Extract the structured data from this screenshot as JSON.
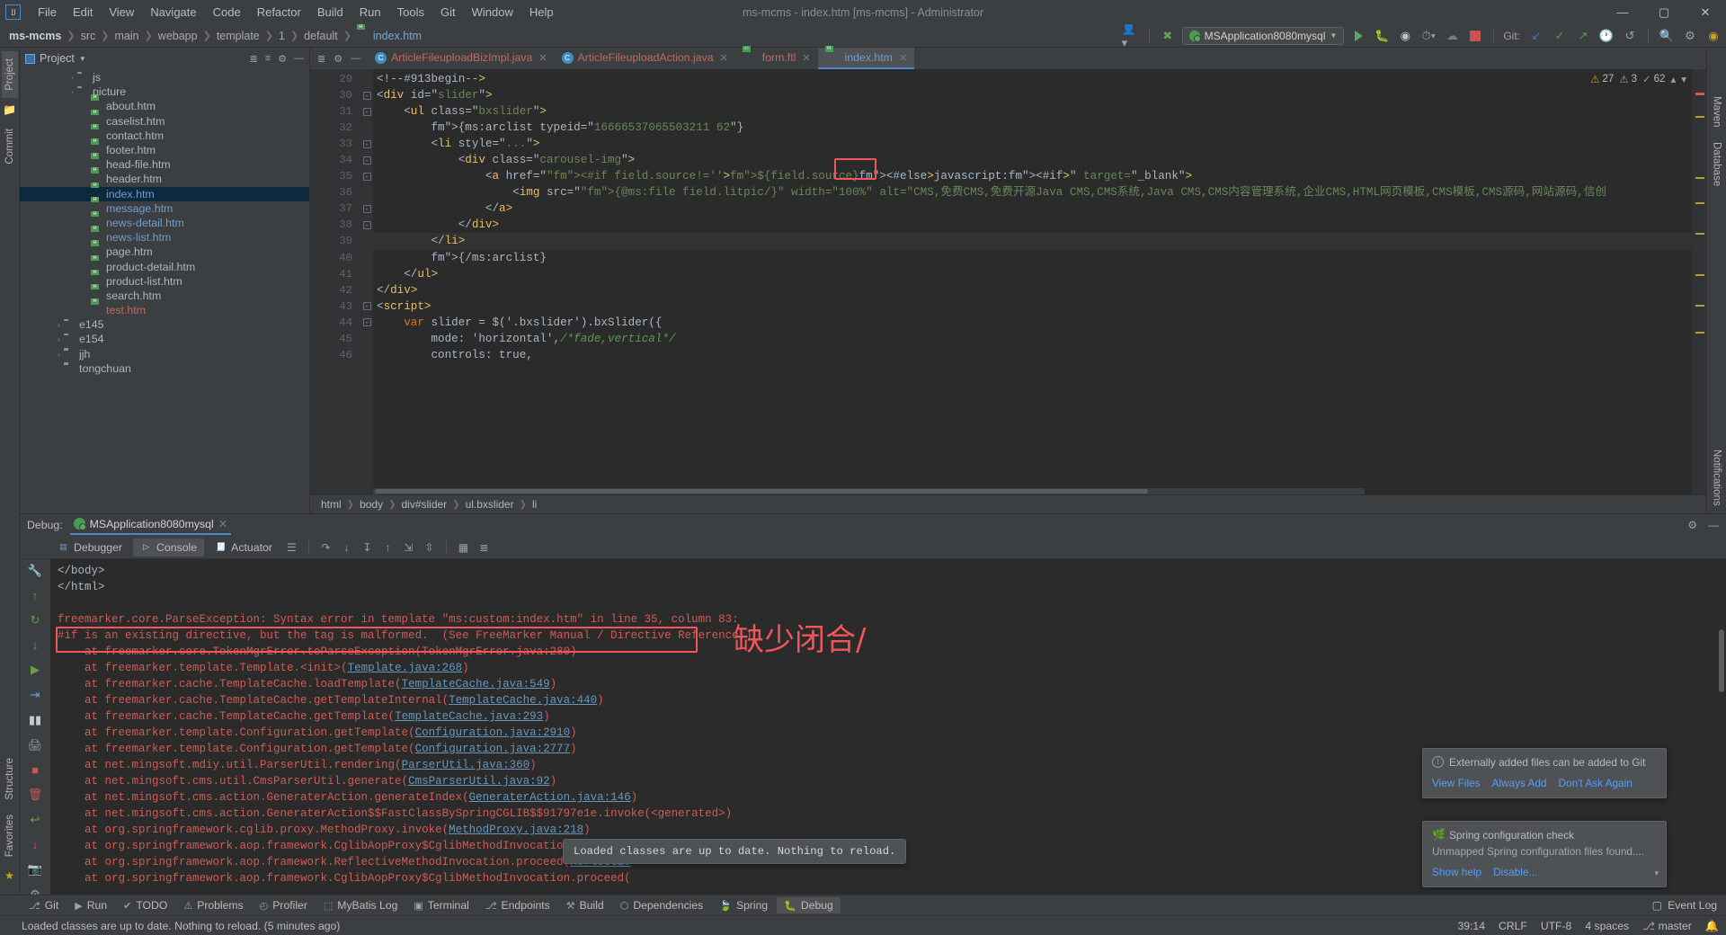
{
  "window": {
    "title": "ms-mcms - index.htm [ms-mcms] - Administrator",
    "minimize": "—",
    "maximize": "▢",
    "close": "✕"
  },
  "menubar": {
    "logo": "IJ",
    "items": [
      "File",
      "Edit",
      "View",
      "Navigate",
      "Code",
      "Refactor",
      "Build",
      "Run",
      "Tools",
      "Git",
      "Window",
      "Help"
    ]
  },
  "navbar": {
    "crumbs": [
      "ms-mcms",
      "src",
      "main",
      "webapp",
      "template",
      "1",
      "default",
      "index.htm"
    ],
    "run_config": "MSApplication8080mysql",
    "git_label": "Git:",
    "icons": {
      "user": "user-icon",
      "hammer": "build-icon",
      "run": "run-icon",
      "debug": "debug-icon",
      "coverage": "coverage-icon",
      "profile": "profile-icon",
      "stop": "stop-icon",
      "update": "git-update-icon",
      "commit": "git-commit-icon",
      "push": "git-push-icon",
      "history": "git-history-icon",
      "rollback": "git-rollback-icon",
      "search": "search-everywhere-icon",
      "settings": "settings-icon",
      "avatar": "account-icon"
    }
  },
  "left_strip": {
    "tabs": [
      "Project",
      "Commit"
    ],
    "bottom_tabs": [
      "Structure",
      "Favorites"
    ]
  },
  "right_strip": {
    "tabs": [
      "Maven",
      "Database",
      "Notifications"
    ]
  },
  "project_panel": {
    "title": "Project",
    "tree": [
      {
        "indent": 3,
        "arrow": "›",
        "icon": "folder",
        "label": "js",
        "color": "gray",
        "sel": false
      },
      {
        "indent": 3,
        "arrow": "›",
        "icon": "folder",
        "label": "picture",
        "color": "gray",
        "sel": false
      },
      {
        "indent": 4,
        "arrow": "",
        "icon": "htm",
        "label": "about.htm",
        "color": "gray",
        "sel": false
      },
      {
        "indent": 4,
        "arrow": "",
        "icon": "htm",
        "label": "caselist.htm",
        "color": "gray",
        "sel": false
      },
      {
        "indent": 4,
        "arrow": "",
        "icon": "htm",
        "label": "contact.htm",
        "color": "gray",
        "sel": false
      },
      {
        "indent": 4,
        "arrow": "",
        "icon": "htm",
        "label": "footer.htm",
        "color": "gray",
        "sel": false
      },
      {
        "indent": 4,
        "arrow": "",
        "icon": "htm",
        "label": "head-file.htm",
        "color": "gray",
        "sel": false
      },
      {
        "indent": 4,
        "arrow": "",
        "icon": "htm",
        "label": "header.htm",
        "color": "gray",
        "sel": false
      },
      {
        "indent": 4,
        "arrow": "",
        "icon": "htm",
        "label": "index.htm",
        "color": "blue",
        "sel": true
      },
      {
        "indent": 4,
        "arrow": "",
        "icon": "htm",
        "label": "message.htm",
        "color": "blue",
        "sel": false
      },
      {
        "indent": 4,
        "arrow": "",
        "icon": "htm",
        "label": "news-detail.htm",
        "color": "blue",
        "sel": false
      },
      {
        "indent": 4,
        "arrow": "",
        "icon": "htm",
        "label": "news-list.htm",
        "color": "blue",
        "sel": false
      },
      {
        "indent": 4,
        "arrow": "",
        "icon": "htm",
        "label": "page.htm",
        "color": "gray",
        "sel": false
      },
      {
        "indent": 4,
        "arrow": "",
        "icon": "htm",
        "label": "product-detail.htm",
        "color": "gray",
        "sel": false
      },
      {
        "indent": 4,
        "arrow": "",
        "icon": "htm",
        "label": "product-list.htm",
        "color": "gray",
        "sel": false
      },
      {
        "indent": 4,
        "arrow": "",
        "icon": "htm",
        "label": "search.htm",
        "color": "gray",
        "sel": false
      },
      {
        "indent": 4,
        "arrow": "",
        "icon": "htm",
        "label": "test.htm",
        "color": "red",
        "sel": false
      },
      {
        "indent": 2,
        "arrow": "›",
        "icon": "folder",
        "label": "e145",
        "color": "gray",
        "sel": false
      },
      {
        "indent": 2,
        "arrow": "›",
        "icon": "folder",
        "label": "e154",
        "color": "gray",
        "sel": false
      },
      {
        "indent": 2,
        "arrow": "›",
        "icon": "folder",
        "label": "jjh",
        "color": "gray",
        "sel": false
      },
      {
        "indent": 2,
        "arrow": "",
        "icon": "folder",
        "label": "tongchuan",
        "color": "gray",
        "sel": false
      }
    ]
  },
  "editor": {
    "tabs": [
      {
        "label": "ArticleFileuploadBizImpl.java",
        "icon": "java-class-icon",
        "active": false
      },
      {
        "label": "ArticleFileuploadAction.java",
        "icon": "java-class-icon",
        "active": false
      },
      {
        "label": "form.ftl",
        "icon": "ftl-file-icon",
        "active": false
      },
      {
        "label": "index.htm",
        "icon": "htm-file-icon",
        "active": true
      }
    ],
    "inspections": {
      "warnings": "27",
      "weak": "3",
      "typos": "62"
    },
    "first_line_no": 29,
    "lines": [
      {
        "no": 29,
        "fold": "",
        "text": "<!--#913begin-->",
        "cur": false
      },
      {
        "no": 30,
        "fold": "-",
        "text": "<div id=\"slider\">",
        "cur": false
      },
      {
        "no": 31,
        "fold": "-",
        "text": "    <ul class=\"bxslider\">",
        "cur": false
      },
      {
        "no": 32,
        "fold": "",
        "text": "        {ms:arclist typeid=\"16666537065503211 62\"}",
        "cur": false
      },
      {
        "no": 33,
        "fold": "-",
        "text": "        <li style=\"...\">",
        "cur": false
      },
      {
        "no": 34,
        "fold": "-",
        "text": "            <div class=\"carousel-img\">",
        "cur": false
      },
      {
        "no": 35,
        "fold": "-",
        "text": "                <a href=\"<#if field.source!=''>${field.source}<#else>javascript:<#if>\" target=\"_blank\">",
        "cur": false
      },
      {
        "no": 36,
        "fold": "",
        "text": "                    <img src=\"{@ms:file field.litpic/}\" width=\"100%\" alt=\"CMS,免费CMS,免费开源Java CMS,CMS系统,Java CMS,CMS内容管理系统,企业CMS,HTML网页模板,CMS模板,CMS源码,网站源码,信创",
        "cur": false
      },
      {
        "no": 37,
        "fold": "-",
        "text": "                </a>",
        "cur": false
      },
      {
        "no": 38,
        "fold": "-",
        "text": "            </div>",
        "cur": false
      },
      {
        "no": 39,
        "fold": "",
        "text": "        </li>",
        "cur": true
      },
      {
        "no": 40,
        "fold": "",
        "text": "        {/ms:arclist}",
        "cur": false
      },
      {
        "no": 41,
        "fold": "",
        "text": "    </ul>",
        "cur": false
      },
      {
        "no": 42,
        "fold": "",
        "text": "</div>",
        "cur": false
      },
      {
        "no": 43,
        "fold": "-",
        "text": "<script>",
        "cur": false
      },
      {
        "no": 44,
        "fold": "-",
        "text": "    var slider = $('.bxslider').bxSlider({",
        "cur": false
      },
      {
        "no": 45,
        "fold": "",
        "text": "        mode: 'horizontal',/*fade,vertical*/",
        "cur": false
      },
      {
        "no": 46,
        "fold": "",
        "text": "        controls: true,",
        "cur": false
      }
    ],
    "breadcrumbs": [
      "html",
      "body",
      "div#slider",
      "ul.bxslider",
      "li"
    ]
  },
  "debug_panel": {
    "label": "Debug:",
    "session_tab": "MSApplication8080mysql",
    "tabs": [
      {
        "label": "Debugger",
        "icon": "debugger-icon",
        "active": false
      },
      {
        "label": "Console",
        "icon": "console-icon",
        "active": true
      },
      {
        "label": "Actuator",
        "icon": "actuator-icon",
        "active": false
      }
    ],
    "toolbar_icons": [
      "layout-icon",
      "step-over-icon",
      "step-into-icon",
      "force-step-into-icon",
      "step-out-icon",
      "run-to-cursor-icon",
      "drop-frame-icon",
      "evaluate-icon",
      "mute-breakpoints-icon"
    ],
    "side_icons": [
      "rerun-icon",
      "up-icon",
      "rerun-failed-icon",
      "down-icon",
      "resume-icon",
      "pause-icon",
      "stop-icon",
      "trash-icon",
      "print-icon",
      "soft-wrap-icon",
      "scroll-to-end-icon",
      "camera-icon",
      "settings-icon",
      "pin-icon"
    ],
    "console_lines": [
      {
        "type": "plain",
        "text": "</body>"
      },
      {
        "type": "plain",
        "text": "</html>"
      },
      {
        "type": "blank",
        "text": ""
      },
      {
        "type": "err",
        "text": "freemarker.core.ParseException: Syntax error in template \"ms:custom:index.htm\" in line 35, column 83:"
      },
      {
        "type": "err",
        "text": "#if is an existing directive, but the tag is malformed.  (See FreeMarker Manual / Directive Reference.)"
      },
      {
        "type": "err",
        "text": "    at freemarker.core.TokenMgrError.toParseException(TokenMgrError.java:280)"
      },
      {
        "type": "trace",
        "text": "    at freemarker.template.Template.<init>(",
        "link": "Template.java:268",
        "tail": ")"
      },
      {
        "type": "trace",
        "text": "    at freemarker.cache.TemplateCache.loadTemplate(",
        "link": "TemplateCache.java:549",
        "tail": ")"
      },
      {
        "type": "trace",
        "text": "    at freemarker.cache.TemplateCache.getTemplateInternal(",
        "link": "TemplateCache.java:440",
        "tail": ")"
      },
      {
        "type": "trace",
        "text": "    at freemarker.cache.TemplateCache.getTemplate(",
        "link": "TemplateCache.java:293",
        "tail": ")"
      },
      {
        "type": "trace",
        "text": "    at freemarker.template.Configuration.getTemplate(",
        "link": "Configuration.java:2910",
        "tail": ")"
      },
      {
        "type": "trace",
        "text": "    at freemarker.template.Configuration.getTemplate(",
        "link": "Configuration.java:2777",
        "tail": ")"
      },
      {
        "type": "trace",
        "text": "    at net.mingsoft.mdiy.util.ParserUtil.rendering(",
        "link": "ParserUtil.java:360",
        "tail": ")"
      },
      {
        "type": "trace",
        "text": "    at net.mingsoft.cms.util.CmsParserUtil.generate(",
        "link": "CmsParserUtil.java:92",
        "tail": ")"
      },
      {
        "type": "trace",
        "text": "    at net.mingsoft.cms.action.GeneraterAction.generateIndex(",
        "link": "GeneraterAction.java:146",
        "tail": ")"
      },
      {
        "type": "trace",
        "text": "    at net.mingsoft.cms.action.GeneraterAction$$FastClassBySpringCGLIB$$91797e1e.invoke(<generated>)",
        "link": "",
        "tail": ""
      },
      {
        "type": "trace",
        "text": "    at org.springframework.cglib.proxy.MethodProxy.invoke(",
        "link": "MethodProxy.java:218",
        "tail": ")"
      },
      {
        "type": "trace",
        "text": "    at org.springframework.aop.framework.CglibAopProxy$CglibMethodInvocation.invokeJoinpoint(",
        "link": "CglibAopProxy.java:792",
        "tail": ")"
      },
      {
        "type": "trace",
        "text": "    at org.springframework.aop.framework.ReflectiveMethodInvocation.proceed(",
        "link": "Reflectiv",
        "tail": ""
      },
      {
        "type": "trace",
        "text": "    at org.springframework.aop.framework.CglibAopProxy$CglibMethodInvocation.proceed(",
        "link": "",
        "tail": ""
      }
    ],
    "annotation": "缺少闭合/"
  },
  "tooltip": {
    "text": "Loaded classes are up to date. Nothing to reload."
  },
  "notifications": [
    {
      "icon": "info-icon",
      "title": "Externally added files can be added to Git",
      "sub": "",
      "links": [
        "View Files",
        "Always Add",
        "Don't Ask Again"
      ]
    },
    {
      "icon": "spring-icon",
      "title": "Spring configuration check",
      "sub": "Unmapped Spring configuration files found....",
      "links": [
        "Show help",
        "Disable..."
      ]
    }
  ],
  "bottom_bar": {
    "tools": [
      {
        "label": "Git",
        "icon": "git-icon",
        "active": false
      },
      {
        "label": "Run",
        "icon": "run-icon",
        "active": false
      },
      {
        "label": "TODO",
        "icon": "todo-icon",
        "active": false
      },
      {
        "label": "Problems",
        "icon": "problems-icon",
        "active": false
      },
      {
        "label": "Profiler",
        "icon": "profiler-icon",
        "active": false
      },
      {
        "label": "MyBatis Log",
        "icon": "mybatis-icon",
        "active": false
      },
      {
        "label": "Terminal",
        "icon": "terminal-icon",
        "active": false
      },
      {
        "label": "Endpoints",
        "icon": "endpoints-icon",
        "active": false
      },
      {
        "label": "Build",
        "icon": "build-icon",
        "active": false
      },
      {
        "label": "Dependencies",
        "icon": "dependencies-icon",
        "active": false
      },
      {
        "label": "Spring",
        "icon": "spring-icon",
        "active": false
      },
      {
        "label": "Debug",
        "icon": "debug-icon",
        "active": true
      }
    ],
    "event_log": "Event Log"
  },
  "statusbar": {
    "message": "Loaded classes are up to date. Nothing to reload. (5 minutes ago)",
    "caret": "39:14",
    "line_sep": "CRLF",
    "encoding": "UTF-8",
    "indent": "4 spaces",
    "branch": "master"
  },
  "colors": {
    "accent": "#4a88c7",
    "error": "#cf5b56",
    "annotation": "#f2555a",
    "green": "#59a869",
    "bg": "#3c3f41",
    "editor_bg": "#2b2b2b"
  }
}
